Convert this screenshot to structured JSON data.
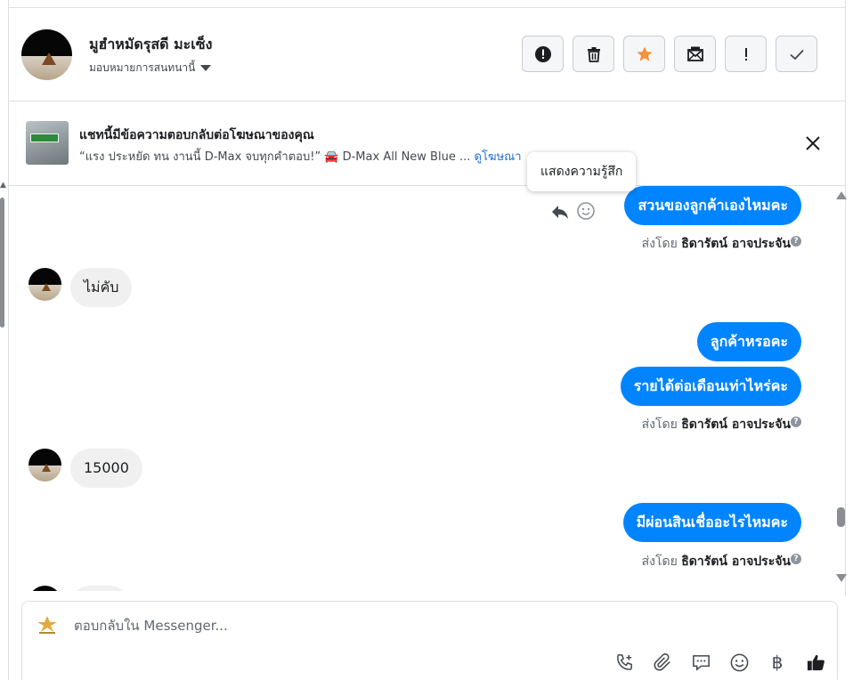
{
  "header": {
    "contact_name": "มูฮำหมัดรุสดี มะเซ็ง",
    "assign_label": "มอบหมายการสนทนานี้",
    "actions": [
      {
        "name": "spam-button",
        "icon": "alert-circle-icon"
      },
      {
        "name": "delete-button",
        "icon": "trash-icon"
      },
      {
        "name": "star-button",
        "icon": "star-icon"
      },
      {
        "name": "mark-unread-button",
        "icon": "mail-icon"
      },
      {
        "name": "follow-up-button",
        "icon": "exclamation-icon"
      },
      {
        "name": "mark-done-button",
        "icon": "check-icon"
      }
    ]
  },
  "banner": {
    "title": "แชทนี้มีข้อความตอบกลับต่อโฆษณาของคุณ",
    "subtitle": "“แรง ประหยัด ทน งานนี้ D-Max จบทุกคำตอบ!” 🚘 D-Max All New Blue ...",
    "link": "ดูโฆษณา"
  },
  "tooltip": "แสดงความรู้สึก",
  "messages": {
    "m1": "สวนของลูกค้าเองไหมคะ",
    "m2": "ไม่คับ",
    "m3": "ลูกค้าหรอคะ",
    "m4": "รายได้ต่อเดือนเท่าไหร่คะ",
    "m5": "15000",
    "m6": "มีผ่อนสินเชื่ออะไรไหมคะ"
  },
  "sent_by": {
    "prefix": "ส่งโดย",
    "agent": "ธิดารัตน์ อาจประจัน"
  },
  "composer": {
    "placeholder": "ตอบกลับใน Messenger...",
    "tools": [
      "phone-add-icon",
      "paperclip-icon",
      "saved-reply-icon",
      "emoji-icon",
      "baht-icon",
      "like-icon"
    ],
    "baht_symbol": "฿"
  },
  "colors": {
    "accent": "#0084ff",
    "star": "#f5923e",
    "incoming_bg": "#f0f0f0"
  }
}
